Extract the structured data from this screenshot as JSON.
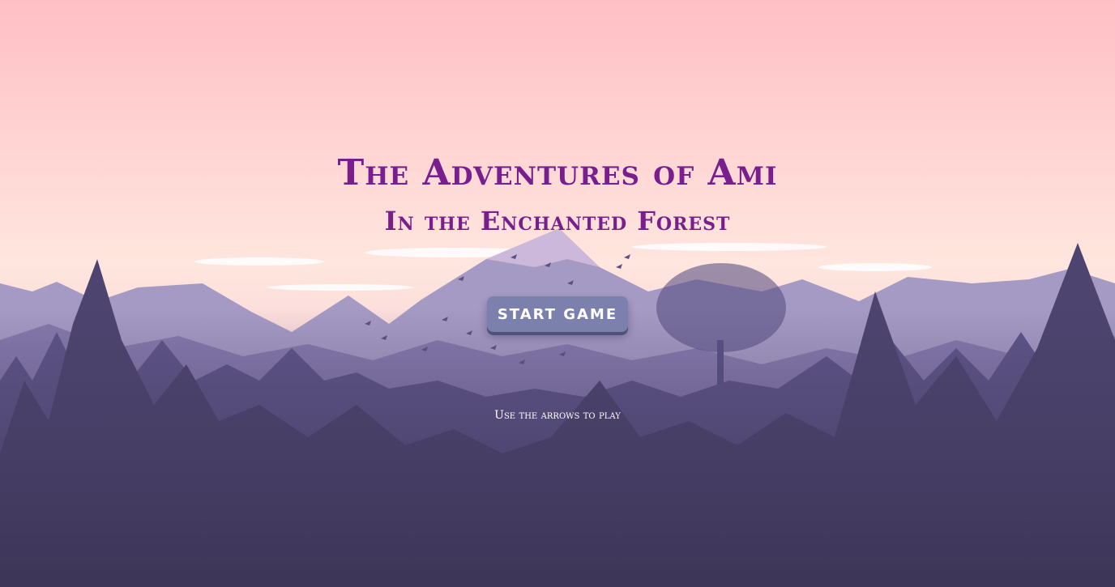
{
  "game": {
    "title": "The Adventures of Ami",
    "subtitle": "In the Enchanted Forest",
    "start_label": "START GAME",
    "hint": "Use the arrows to play"
  },
  "colors": {
    "sky_top": "#ffbfc5",
    "sky_mid": "#ffe6de",
    "title": "#7a1e8e",
    "button": "#7c80ad",
    "forest_dark": "#3e3a5c"
  }
}
